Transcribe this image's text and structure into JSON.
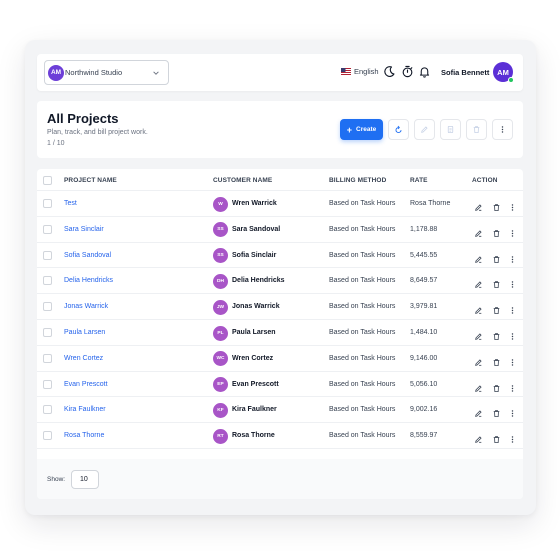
{
  "topbar": {
    "org_initials": "AM",
    "org_name": "Northwind Studio",
    "language": "English",
    "user_name": "Sofia Bennett",
    "user_initials": "AM"
  },
  "header": {
    "title": "All Projects",
    "subtitle": "Plan, track, and bill project work.",
    "count": "1 / 10",
    "create_label": "Create"
  },
  "table": {
    "columns": [
      "PROJECT NAME",
      "CUSTOMER NAME",
      "BILLING METHOD",
      "RATE",
      "ACTION"
    ],
    "rows": [
      {
        "project": "Test",
        "initials": "W",
        "customer": "Wren Warrick",
        "billing": "Based on Task Hours",
        "rate": "Rosa Thorne"
      },
      {
        "project": "Sara Sinclair",
        "initials": "SS",
        "customer": "Sara Sandoval",
        "billing": "Based on Task Hours",
        "rate": "1,178.88"
      },
      {
        "project": "Sofia Sandoval",
        "initials": "SS",
        "customer": "Sofia Sinclair",
        "billing": "Based on Task Hours",
        "rate": "5,445.55"
      },
      {
        "project": "Delia Hendricks",
        "initials": "DH",
        "customer": "Delia Hendricks",
        "billing": "Based on Task Hours",
        "rate": "8,649.57"
      },
      {
        "project": "Jonas Warrick",
        "initials": "JW",
        "customer": "Jonas Warrick",
        "billing": "Based on Task Hours",
        "rate": "3,979.81"
      },
      {
        "project": "Paula Larsen",
        "initials": "PL",
        "customer": "Paula Larsen",
        "billing": "Based on Task Hours",
        "rate": "1,484.10"
      },
      {
        "project": "Wren Cortez",
        "initials": "WC",
        "customer": "Wren Cortez",
        "billing": "Based on Task Hours",
        "rate": "9,146.00"
      },
      {
        "project": "Evan Prescott",
        "initials": "EP",
        "customer": "Evan Prescott",
        "billing": "Based on Task Hours",
        "rate": "5,056.10"
      },
      {
        "project": "Kira Faulkner",
        "initials": "KF",
        "customer": "Kira Faulkner",
        "billing": "Based on Task Hours",
        "rate": "9,002.16"
      },
      {
        "project": "Rosa Thorne",
        "initials": "RT",
        "customer": "Rosa Thorne",
        "billing": "Based on Task Hours",
        "rate": "8,559.97"
      }
    ]
  },
  "footer": {
    "show_label": "Show:",
    "page_size": "10"
  },
  "colors": {
    "accent": "#1f6ff2",
    "avatar": "#a855c7",
    "user_avatar": "#5b2fd6",
    "link": "#2563eb",
    "online": "#22c55e"
  },
  "icons": [
    "chevron-down-icon",
    "us-flag-icon",
    "moon-icon",
    "timer-icon",
    "bell-icon",
    "plus-icon",
    "refresh-icon",
    "edit-icon",
    "trash-icon",
    "more-vertical-icon"
  ]
}
